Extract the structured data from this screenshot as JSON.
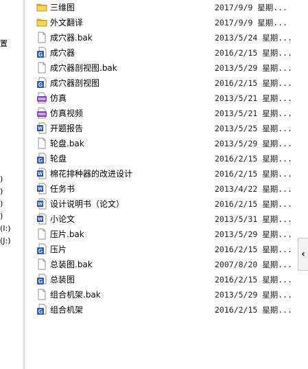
{
  "nav": {
    "items": [
      {
        "label": "置"
      },
      {
        "label": ")"
      },
      {
        "label": ")"
      },
      {
        "label": ")"
      },
      {
        "label": ")"
      },
      {
        "label": "(I:)"
      },
      {
        "label": "(J:)"
      }
    ]
  },
  "files": [
    {
      "name": "三维图",
      "date": "2017/9/9 星期...",
      "icon": "folder-icon"
    },
    {
      "name": "外文翻译",
      "date": "2017/9/9 星期...",
      "icon": "folder-icon"
    },
    {
      "name": "成穴器.bak",
      "date": "2013/5/24 星期...",
      "icon": "blank-file-icon"
    },
    {
      "name": "成穴器",
      "date": "2016/2/15 星期...",
      "icon": "solidworks-file-icon"
    },
    {
      "name": "成穴器剖视图.bak",
      "date": "2013/5/29 星期...",
      "icon": "blank-file-icon"
    },
    {
      "name": "成穴器剖视图",
      "date": "2016/2/15 星期...",
      "icon": "solidworks-file-icon"
    },
    {
      "name": "仿真",
      "date": "2013/5/21 星期...",
      "icon": "video-file-icon"
    },
    {
      "name": "仿真视频",
      "date": "2013/5/21 星期...",
      "icon": "video-file-icon"
    },
    {
      "name": "开题报告",
      "date": "2013/5/25 星期...",
      "icon": "word-doc-icon"
    },
    {
      "name": "轮盘.bak",
      "date": "2013/5/29 星期...",
      "icon": "blank-file-icon"
    },
    {
      "name": "轮盘",
      "date": "2016/2/15 星期...",
      "icon": "solidworks-file-icon"
    },
    {
      "name": "棉花排种器的改进设计",
      "date": "2016/2/15 星期...",
      "icon": "word-doc-icon"
    },
    {
      "name": "任务书",
      "date": "2013/4/22 星期...",
      "icon": "word-doc-icon"
    },
    {
      "name": "设计说明书（论文）",
      "date": "2016/2/15 星期...",
      "icon": "word-doc-icon"
    },
    {
      "name": "小论文",
      "date": "2013/5/31 星期...",
      "icon": "word-doc-icon"
    },
    {
      "name": "压片.bak",
      "date": "2013/5/29 星期...",
      "icon": "blank-file-icon"
    },
    {
      "name": "压片",
      "date": "2016/2/15 星期...",
      "icon": "solidworks-file-icon"
    },
    {
      "name": "总装图.bak",
      "date": "2007/8/20 星期...",
      "icon": "blank-file-icon"
    },
    {
      "name": "总装图",
      "date": "2016/2/15 星期...",
      "icon": "solidworks-file-icon"
    },
    {
      "name": "组合机架.bak",
      "date": "2013/5/29 星期...",
      "icon": "blank-file-icon"
    },
    {
      "name": "组合机架",
      "date": "2016/2/15 星期...",
      "icon": "solidworks-file-icon"
    }
  ],
  "expand_button": {
    "glyph": "‹"
  },
  "colors": {
    "folder": "#e8b930",
    "solidworks": "#2a5db0",
    "word": "#2b579a",
    "video": "#7a3aa8"
  }
}
